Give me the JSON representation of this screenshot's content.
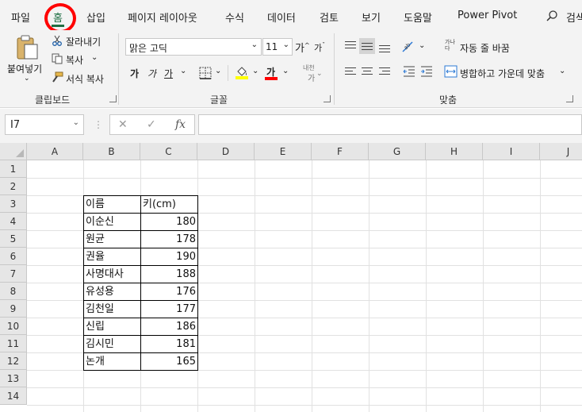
{
  "tabs": [
    "파일",
    "홈",
    "삽입",
    "페이지 레이아웃",
    "수식",
    "데이터",
    "검토",
    "보기",
    "도움말",
    "Power Pivot"
  ],
  "active_tab": "홈",
  "search_label": "검색",
  "clipboard": {
    "paste": "붙여넣기",
    "cut": "잘라내기",
    "copy": "복사",
    "format_painter": "서식 복사",
    "group_label": "클립보드"
  },
  "font": {
    "name": "맑은 고딕",
    "size": "11",
    "grow": "가",
    "shrink": "가",
    "bold": "가",
    "italic": "가",
    "underline": "가",
    "font_color_glyph": "가",
    "phonetic_top": "내천",
    "phonetic_bottom": "가",
    "group_label": "글꼴",
    "fill_color": "#ffff00",
    "text_color": "#ff0000"
  },
  "alignment": {
    "wrap_text": "자동 줄 바꿈",
    "wrap_icon_top": "가나",
    "wrap_icon_bottom": "다",
    "merge_center": "병합하고 가운데 맞춤",
    "group_label": "맞춤"
  },
  "formula_bar": {
    "name_box": "I7",
    "formula": ""
  },
  "columns": [
    "A",
    "B",
    "C",
    "D",
    "E",
    "F",
    "G",
    "H",
    "I",
    "J"
  ],
  "rows": [
    "1",
    "2",
    "3",
    "4",
    "5",
    "6",
    "7",
    "8",
    "9",
    "10",
    "11",
    "12",
    "13",
    "14"
  ],
  "table": {
    "headers": [
      "이름",
      "키(cm)"
    ],
    "rows": [
      [
        "이순신",
        "180"
      ],
      [
        "원균",
        "178"
      ],
      [
        "권율",
        "190"
      ],
      [
        "사명대사",
        "188"
      ],
      [
        "유성용",
        "176"
      ],
      [
        "김천일",
        "177"
      ],
      [
        "신립",
        "186"
      ],
      [
        "김시민",
        "181"
      ],
      [
        "논개",
        "165"
      ]
    ]
  },
  "accent_color": "#1f6e43",
  "annotation_color": "#ff0000"
}
